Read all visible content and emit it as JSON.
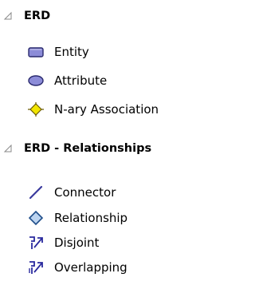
{
  "toolbox": {
    "groups": [
      {
        "title": "ERD",
        "expanded": true,
        "items": [
          {
            "label": "Entity",
            "icon": "entity-icon"
          },
          {
            "label": "Attribute",
            "icon": "attribute-icon"
          },
          {
            "label": "N-ary Association",
            "icon": "nary-association-icon"
          }
        ]
      },
      {
        "title": "ERD - Relationships",
        "expanded": true,
        "items": [
          {
            "label": "Connector",
            "icon": "connector-icon"
          },
          {
            "label": "Relationship",
            "icon": "relationship-icon"
          },
          {
            "label": "Disjoint",
            "icon": "disjoint-icon"
          },
          {
            "label": "Overlapping",
            "icon": "overlapping-icon"
          }
        ]
      }
    ]
  },
  "colors": {
    "expander": "#8a8a8a",
    "entity_fill": "#8c8cd8",
    "entity_stroke": "#2a2a6e",
    "attribute_fill": "#8c8cd8",
    "attribute_stroke": "#2a2a6e",
    "nary_fill": "#f2e600",
    "nary_stroke": "#6b5a00",
    "connector": "#3a3a9e",
    "relationship_fill": "#bcd4f0",
    "relationship_stroke": "#1f4e8a",
    "disjoint": "#2a2a9e",
    "overlapping": "#2a2a9e"
  }
}
